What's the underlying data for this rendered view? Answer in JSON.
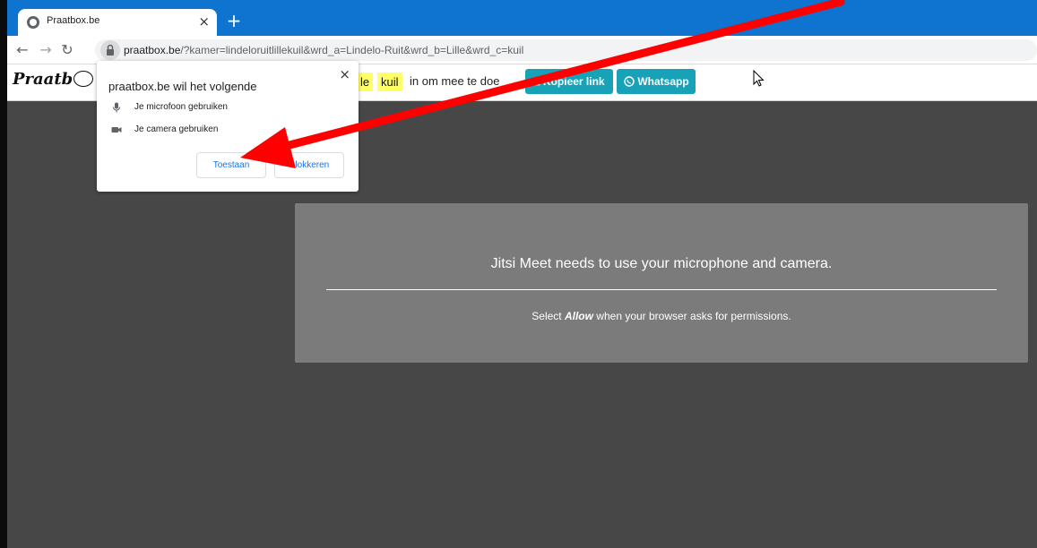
{
  "browser": {
    "tab_title": "Praatbox.be",
    "tab_close": "×",
    "new_tab": "+",
    "url_host": "praatbox.be",
    "url_path": "/?kamer=lindeloruitlillekuil&wrd_a=Lindelo-Ruit&wrd_b=Lille&wrd_c=kuil"
  },
  "site": {
    "logo_text": "Praatb",
    "word_b_partial": "le",
    "word_c": "kuil",
    "instruction": "in om mee te doe",
    "copy_link_label": "Kopieer link",
    "whatsapp_label": "Whatsapp"
  },
  "meeting": {
    "title": "Jitsi Meet needs to use your microphone and camera.",
    "sub_prefix": "Select ",
    "sub_bold": "Allow",
    "sub_suffix": " when your browser asks for permissions."
  },
  "popup": {
    "title": "praatbox.be wil het volgende",
    "close": "×",
    "mic_label": "Je microfoon gebruiken",
    "camera_label": "Je camera gebruiken",
    "allow_label": "Toestaan",
    "block_label": "Blokkeren"
  },
  "colors": {
    "tabstrip": "#0f74d0",
    "teal_button": "#17a2b8",
    "word_highlight": "#ffff66",
    "meeting_bg": "#474747",
    "overlay_bg": "#7b7b7b",
    "arrow": "#ff0000"
  },
  "icons": [
    "globe-icon",
    "back-arrow-icon",
    "forward-arrow-icon",
    "reload-icon",
    "lock-icon",
    "microphone-icon",
    "camera-icon",
    "whatsapp-icon",
    "copy-icon",
    "mouse-cursor-icon"
  ]
}
